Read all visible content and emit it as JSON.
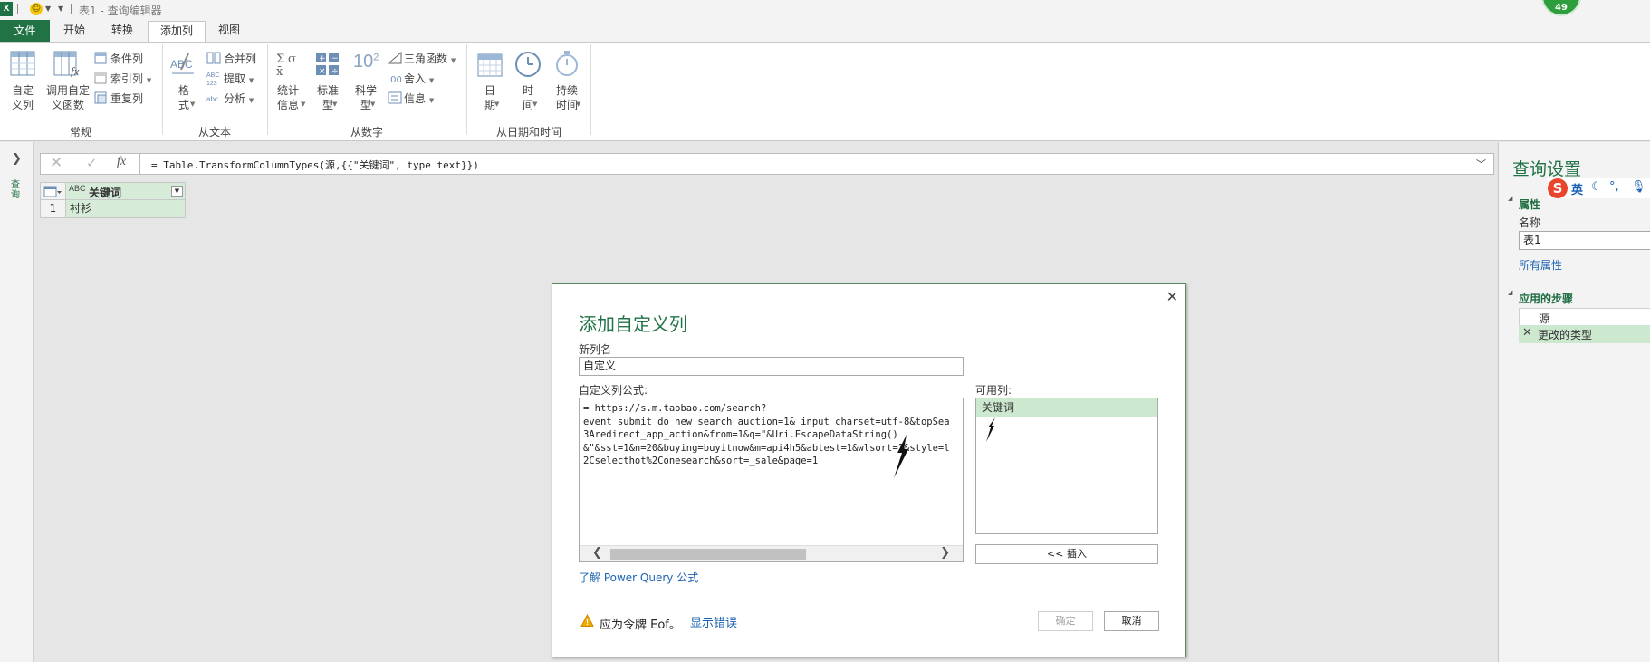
{
  "window": {
    "title": "表1 - 查询编辑器",
    "badge_count": "49"
  },
  "tabs": [
    {
      "label": "文件"
    },
    {
      "label": "开始"
    },
    {
      "label": "转换"
    },
    {
      "label": "添加列"
    },
    {
      "label": "视图"
    }
  ],
  "ribbon": {
    "custom_column": "自定\n义列",
    "invoke_custom_fn": "调用自定\n义函数",
    "conditional_col": "条件列",
    "index_col": "索引列",
    "duplicate_col": "重复列",
    "format": "格\n式",
    "merge_cols": "合并列",
    "extract": "提取",
    "parse": "分析",
    "statistics": "统计\n信息",
    "standard": "标准\n型",
    "scientific": "科学\n型",
    "trig": "三角函数",
    "rounding": "舍入",
    "information": "信息",
    "date": "日\n期",
    "time": "时\n间",
    "duration": "持续\n时间",
    "group_general": "常规",
    "group_text": "从文本",
    "group_number": "从数字",
    "group_datetime": "从日期和时间",
    "sci_icon_text": "10"
  },
  "left_pane": {
    "label": "查询"
  },
  "formula_bar": {
    "fx": "fx",
    "formula": "= Table.TransformColumnTypes(源,{{\"关键词\", type text}})"
  },
  "grid": {
    "column_header": "关键词",
    "type_label": "ABC",
    "rows": [
      {
        "index": "1",
        "value": "衬衫"
      }
    ]
  },
  "right_pane": {
    "title": "查询设置",
    "ime_english": "英",
    "properties_label": "属性",
    "name_label": "名称",
    "name_value": "表1",
    "all_properties": "所有属性",
    "applied_steps_label": "应用的步骤",
    "steps": [
      {
        "label": "源"
      },
      {
        "label": "更改的类型"
      }
    ]
  },
  "dialog": {
    "title": "添加自定义列",
    "new_col_label": "新列名",
    "new_col_value": "自定义",
    "formula_label": "自定义列公式:",
    "formula_lines": [
      "= https://s.m.taobao.com/search?",
      "event_submit_do_new_search_auction=1&_input_charset=utf-8&topSea",
      "3Aredirect_app_action&from=1&q=\"&Uri.EscapeDataString()",
      "&\"&sst=1&n=20&buying=buyitnow&m=api4h5&abtest=1&wlsort=1&style=l",
      "2Cselecthot%2Conesearch&sort=_sale&page=1"
    ],
    "available_cols_label": "可用列:",
    "available_cols": [
      "关键词"
    ],
    "insert_button": "<< 插入",
    "learn_link": "了解 Power Query 公式",
    "error_text": "应为令牌 Eof。",
    "show_errors": "显示错误",
    "ok_button": "确定",
    "cancel_button": "取消"
  },
  "colors": {
    "accent": "#217346",
    "header_green": "#d6ecd9",
    "selected_row": "#cce8cf",
    "link": "#1d62b3"
  }
}
